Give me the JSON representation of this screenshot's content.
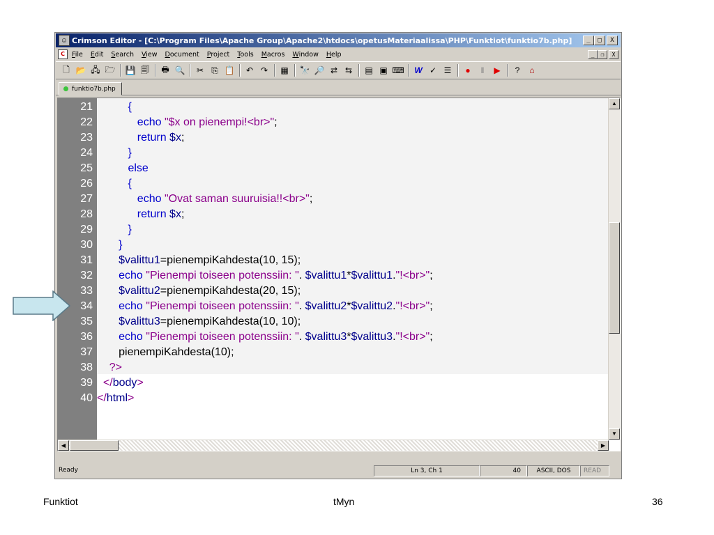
{
  "window": {
    "title": "Crimson Editor - [C:\\Program Files\\Apache Group\\Apache2\\htdocs\\opetusMateriaalissa\\PHP\\Funktiot\\funktio7b.php]",
    "minimize_glyph": "_",
    "maximize_glyph": "□",
    "close_glyph": "X",
    "restore_glyph": "❐"
  },
  "menubar": {
    "items": [
      {
        "accel": "F",
        "rest": "ile"
      },
      {
        "accel": "E",
        "rest": "dit"
      },
      {
        "accel": "S",
        "rest": "earch"
      },
      {
        "accel": "V",
        "rest": "iew"
      },
      {
        "accel": "D",
        "rest": "ocument"
      },
      {
        "accel": "P",
        "rest": "roject"
      },
      {
        "accel": "T",
        "rest": "ools"
      },
      {
        "accel": "M",
        "rest": "acros"
      },
      {
        "accel": "W",
        "rest": "indow"
      },
      {
        "accel": "H",
        "rest": "elp"
      }
    ]
  },
  "toolbar": {
    "icons": [
      "new-file-icon",
      "open-folder-icon",
      "open-remote-icon",
      "open-project-icon",
      "save-icon",
      "save-all-icon",
      "print-icon",
      "print-preview-icon",
      "cut-icon",
      "copy-icon",
      "paste-icon",
      "undo-icon",
      "redo-icon",
      "column-mode-icon",
      "find-icon",
      "find-next-icon",
      "replace-icon",
      "replace-next-icon",
      "toggle-panel-icon",
      "output-window-icon",
      "macro-icon",
      "word-wrap-icon",
      "spell-check-icon",
      "line-numbers-icon",
      "record-icon",
      "pause-icon",
      "play-icon",
      "help-icon",
      "home-icon"
    ]
  },
  "tab": {
    "label": "funktio7b.php",
    "status_color": "#3cc43c"
  },
  "editor": {
    "lines": [
      {
        "num": "21",
        "indent": "          ",
        "tokens": [
          {
            "t": "{",
            "c": "kw"
          }
        ]
      },
      {
        "num": "22",
        "indent": "             ",
        "tokens": [
          {
            "t": "echo ",
            "c": "kw"
          },
          {
            "t": "\"$x on pienempi!<br>\"",
            "c": "str"
          },
          {
            "t": ";",
            "c": "fn"
          }
        ]
      },
      {
        "num": "23",
        "indent": "             ",
        "tokens": [
          {
            "t": "return ",
            "c": "kw"
          },
          {
            "t": "$x",
            "c": "var"
          },
          {
            "t": ";",
            "c": "fn"
          }
        ]
      },
      {
        "num": "24",
        "indent": "          ",
        "tokens": [
          {
            "t": "}",
            "c": "kw"
          }
        ]
      },
      {
        "num": "25",
        "indent": "          ",
        "tokens": [
          {
            "t": "else",
            "c": "kw"
          }
        ]
      },
      {
        "num": "26",
        "indent": "          ",
        "tokens": [
          {
            "t": "{",
            "c": "kw"
          }
        ]
      },
      {
        "num": "27",
        "indent": "             ",
        "tokens": [
          {
            "t": "echo ",
            "c": "kw"
          },
          {
            "t": "\"Ovat saman suuruisia!!<br>\"",
            "c": "str"
          },
          {
            "t": ";",
            "c": "fn"
          }
        ]
      },
      {
        "num": "28",
        "indent": "             ",
        "tokens": [
          {
            "t": "return ",
            "c": "kw"
          },
          {
            "t": "$x",
            "c": "var"
          },
          {
            "t": ";",
            "c": "fn"
          }
        ]
      },
      {
        "num": "29",
        "indent": "          ",
        "tokens": [
          {
            "t": "}",
            "c": "kw"
          }
        ]
      },
      {
        "num": "30",
        "indent": "       ",
        "tokens": [
          {
            "t": "}",
            "c": "kw"
          }
        ]
      },
      {
        "num": "31",
        "indent": "       ",
        "tokens": [
          {
            "t": "$valittu1",
            "c": "var"
          },
          {
            "t": "=pienempiKahdesta(10, 15);",
            "c": "fn"
          }
        ]
      },
      {
        "num": "32",
        "indent": "       ",
        "tokens": [
          {
            "t": "echo ",
            "c": "kw"
          },
          {
            "t": "\"Pienempi toiseen potenssiin: \"",
            "c": "str"
          },
          {
            "t": ". ",
            "c": "fn"
          },
          {
            "t": "$valittu1",
            "c": "var"
          },
          {
            "t": "*",
            "c": "fn"
          },
          {
            "t": "$valittu1",
            "c": "var"
          },
          {
            "t": ".",
            "c": "fn"
          },
          {
            "t": "\"!<br>\"",
            "c": "str"
          },
          {
            "t": ";",
            "c": "fn"
          }
        ]
      },
      {
        "num": "33",
        "indent": "       ",
        "tokens": [
          {
            "t": "$valittu2",
            "c": "var"
          },
          {
            "t": "=pienempiKahdesta(20, 15);",
            "c": "fn"
          }
        ]
      },
      {
        "num": "34",
        "indent": "       ",
        "tokens": [
          {
            "t": "echo ",
            "c": "kw"
          },
          {
            "t": "\"Pienempi toiseen potenssiin: \"",
            "c": "str"
          },
          {
            "t": ". ",
            "c": "fn"
          },
          {
            "t": "$valittu2",
            "c": "var"
          },
          {
            "t": "*",
            "c": "fn"
          },
          {
            "t": "$valittu2",
            "c": "var"
          },
          {
            "t": ".",
            "c": "fn"
          },
          {
            "t": "\"!<br>\"",
            "c": "str"
          },
          {
            "t": ";",
            "c": "fn"
          }
        ]
      },
      {
        "num": "35",
        "indent": "       ",
        "tokens": [
          {
            "t": "$valittu3",
            "c": "var"
          },
          {
            "t": "=pienempiKahdesta(10, 10);",
            "c": "fn"
          }
        ]
      },
      {
        "num": "36",
        "indent": "       ",
        "tokens": [
          {
            "t": "echo ",
            "c": "kw"
          },
          {
            "t": "\"Pienempi toiseen potenssiin: \"",
            "c": "str"
          },
          {
            "t": ". ",
            "c": "fn"
          },
          {
            "t": "$valittu3",
            "c": "var"
          },
          {
            "t": "*",
            "c": "fn"
          },
          {
            "t": "$valittu3",
            "c": "var"
          },
          {
            "t": ".",
            "c": "fn"
          },
          {
            "t": "\"!<br>\"",
            "c": "str"
          },
          {
            "t": ";",
            "c": "fn"
          }
        ]
      },
      {
        "num": "37",
        "indent": "       ",
        "tokens": [
          {
            "t": "pienempiKahdesta(10);",
            "c": "fn"
          }
        ]
      },
      {
        "num": "38",
        "indent": "    ",
        "tokens": [
          {
            "t": "?>",
            "c": "str"
          }
        ]
      },
      {
        "num": "39",
        "indent": "  ",
        "tokens": [
          {
            "t": "</",
            "c": "str"
          },
          {
            "t": "body",
            "c": "tag"
          },
          {
            "t": ">",
            "c": "str"
          }
        ]
      },
      {
        "num": "40",
        "indent": "",
        "tokens": [
          {
            "t": "</",
            "c": "str"
          },
          {
            "t": "html",
            "c": "tag"
          },
          {
            "t": ">",
            "c": "str"
          }
        ]
      }
    ]
  },
  "statusbar": {
    "ready": "Ready",
    "position": "Ln 3, Ch 1",
    "lines": "40",
    "encoding": "ASCII, DOS",
    "mode": "READ"
  },
  "footer": {
    "left": "Funktiot",
    "center": "tMyn",
    "right": "36"
  },
  "colors": {
    "keyword": "#0000cc",
    "string": "#8b008b",
    "variable": "#00008b",
    "arrow_fill": "#c8e6ee"
  }
}
